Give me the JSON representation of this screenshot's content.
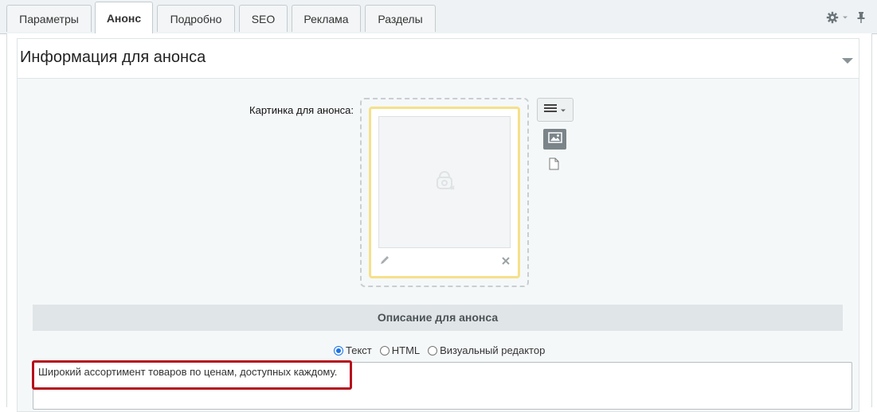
{
  "tabs": [
    {
      "label": "Параметры",
      "active": false
    },
    {
      "label": "Анонс",
      "active": true
    },
    {
      "label": "Подробно",
      "active": false
    },
    {
      "label": "SEO",
      "active": false
    },
    {
      "label": "Реклама",
      "active": false
    },
    {
      "label": "Разделы",
      "active": false
    }
  ],
  "toolbar_icons": [
    "gear-icon",
    "chevron-down-icon",
    "pin-icon"
  ],
  "section": {
    "title": "Информация для анонса"
  },
  "preview_image": {
    "label": "Картинка для анонса:"
  },
  "description": {
    "header": "Описание для анонса",
    "modes": [
      {
        "label": "Текст",
        "checked": true
      },
      {
        "label": "HTML",
        "checked": false
      },
      {
        "label": "Визуальный редактор",
        "checked": false
      }
    ],
    "text": "Широкий ассортимент товаров по ценам, доступных каждому."
  },
  "colors": {
    "highlight": "#b50f1b",
    "image_card_border": "#f6e08a",
    "radio_accent": "#1a73e8"
  }
}
